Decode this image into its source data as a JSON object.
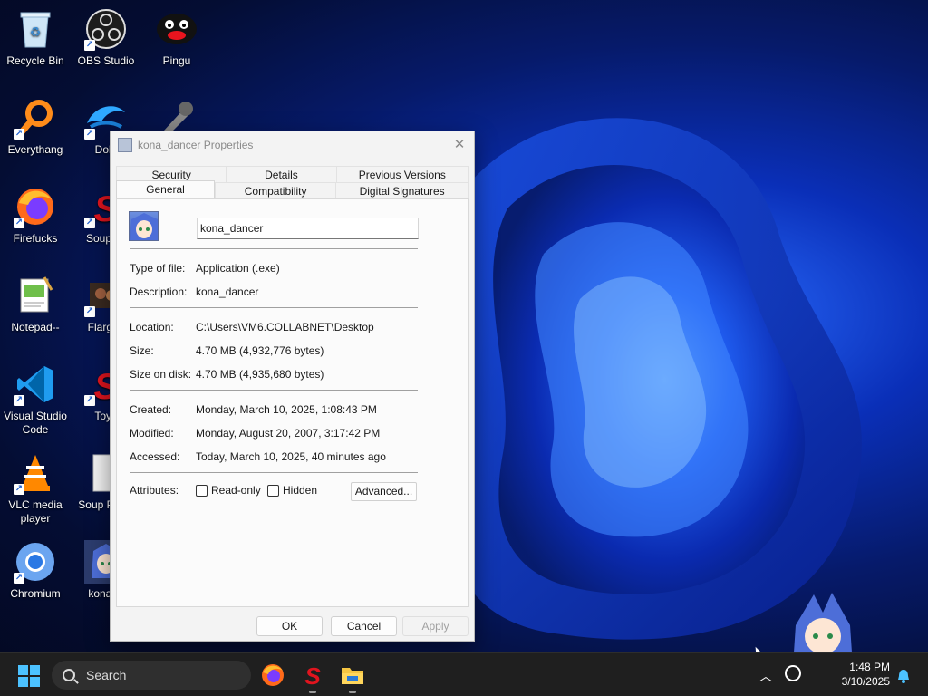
{
  "desktop": {
    "icons": [
      {
        "label": "Recycle Bin",
        "icon": "recycle-bin-icon"
      },
      {
        "label": "OBS Studio",
        "icon": "obs-icon"
      },
      {
        "label": "Pingu",
        "icon": "pingu-icon"
      },
      {
        "label": "Everythang",
        "icon": "magnifier-icon"
      },
      {
        "label": "Dolp",
        "icon": "dolphin-icon"
      },
      {
        "label": "Firefucks",
        "icon": "firefox-icon"
      },
      {
        "label": "Souptoy",
        "icon": "red-s-icon"
      },
      {
        "label": "Notepad--",
        "icon": "notepad-icon"
      },
      {
        "label": "FlargOr",
        "icon": "movie-icon"
      },
      {
        "label": "Visual Studio Code",
        "icon": "vscode-icon"
      },
      {
        "label": "Toyb",
        "icon": "red-s-icon"
      },
      {
        "label": "VLC media player",
        "icon": "vlc-icon"
      },
      {
        "label": "Soup Playe",
        "icon": "document-icon"
      },
      {
        "label": "Chromium",
        "icon": "chromium-icon"
      },
      {
        "label": "kona_d",
        "icon": "anime-icon"
      }
    ]
  },
  "dialog": {
    "title": "kona_dancer Properties",
    "close_glyph": "✕",
    "tabs_row1": [
      "Security",
      "Details",
      "Previous Versions"
    ],
    "tabs_row2": [
      "General",
      "Compatibility",
      "Digital Signatures"
    ],
    "active_tab": "General",
    "name_value": "kona_dancer",
    "fields": {
      "type_label": "Type of file:",
      "type_value": "Application (.exe)",
      "desc_label": "Description:",
      "desc_value": "kona_dancer",
      "location_label": "Location:",
      "location_value": "C:\\Users\\VM6.COLLABNET\\Desktop",
      "size_label": "Size:",
      "size_value": "4.70 MB (4,932,776 bytes)",
      "disk_label": "Size on disk:",
      "disk_value": "4.70 MB (4,935,680 bytes)",
      "created_label": "Created:",
      "created_value": "Monday, March 10, 2025, 1:08:43 PM",
      "modified_label": "Modified:",
      "modified_value": "Monday, August 20, 2007, 3:17:42 PM",
      "accessed_label": "Accessed:",
      "accessed_value": "Today, March 10, 2025, 40 minutes ago"
    },
    "attributes": {
      "label": "Attributes:",
      "readonly": "Read-only",
      "hidden": "Hidden",
      "advanced": "Advanced..."
    },
    "buttons": {
      "ok": "OK",
      "cancel": "Cancel",
      "apply": "Apply"
    }
  },
  "taskbar": {
    "search_label": "Search",
    "time": "1:48 PM",
    "date": "3/10/2025",
    "accent": "#4cc2ff"
  }
}
